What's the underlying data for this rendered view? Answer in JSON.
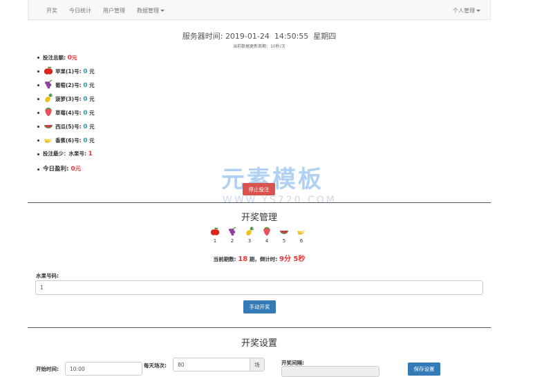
{
  "nav": {
    "items": [
      "开奖",
      "今日统计",
      "用户管理",
      "数据管理"
    ],
    "right": "个人管理"
  },
  "header": {
    "server_time_label": "服务器时间:",
    "date": "2019-01-24",
    "time": "14:50:55",
    "weekday": "星期四",
    "refresh_note": "当前数据更新周期：10秒/次"
  },
  "bets": {
    "total_label": "投注总额:",
    "total_value": "0",
    "unit": "元",
    "fruits": [
      {
        "name": "苹果",
        "num": "(1)",
        "suffix": "号:",
        "value": "0",
        "unit": "元",
        "icon": "apple-icon",
        "color": "#d9261c"
      },
      {
        "name": "葡萄",
        "num": "(2)",
        "suffix": "号:",
        "value": "0",
        "unit": "元",
        "icon": "grape-icon",
        "color": "#8e3fa0"
      },
      {
        "name": "菠萝",
        "num": "(3)",
        "suffix": "号:",
        "value": "0",
        "unit": "元",
        "icon": "pineapple-icon",
        "color": "#f2c21b"
      },
      {
        "name": "草莓",
        "num": "(4)",
        "suffix": "号:",
        "value": "0",
        "unit": "元",
        "icon": "strawberry-icon",
        "color": "#e8505b"
      },
      {
        "name": "西瓜",
        "num": "(5)",
        "suffix": "号:",
        "value": "0",
        "unit": "元",
        "icon": "watermelon-icon",
        "color": "#3f8a3a"
      },
      {
        "name": "香蕉",
        "num": "(6)",
        "suffix": "号:",
        "value": "0",
        "unit": "元",
        "icon": "banana-icon",
        "color": "#f5cf2e"
      }
    ],
    "min_label": "投注最少：水果号:",
    "min_value": "1",
    "profit_label": "今日盈利:",
    "profit_value": "0",
    "profit_unit": "元",
    "stop_button": "停止投注"
  },
  "draw_management": {
    "title": "开奖管理",
    "numbers": [
      "1",
      "2",
      "3",
      "4",
      "5",
      "6"
    ],
    "period_label": "当前期数:",
    "period_value": "18",
    "period_suffix": "期，倒计时:",
    "countdown": "9分 5秒",
    "input_label": "水果号码:",
    "input_value": "1",
    "manual_button": "手动开奖"
  },
  "draw_settings": {
    "title": "开奖设置",
    "start_label": "开始时间:",
    "start_value": "10:00",
    "daily_label": "每天场次:",
    "daily_value": "80",
    "daily_unit": "场",
    "interval_label": "开奖间隔:",
    "save_button": "保存设置"
  },
  "watermark": {
    "text": "元素模板",
    "sub": "WWW.YS720.COM"
  }
}
